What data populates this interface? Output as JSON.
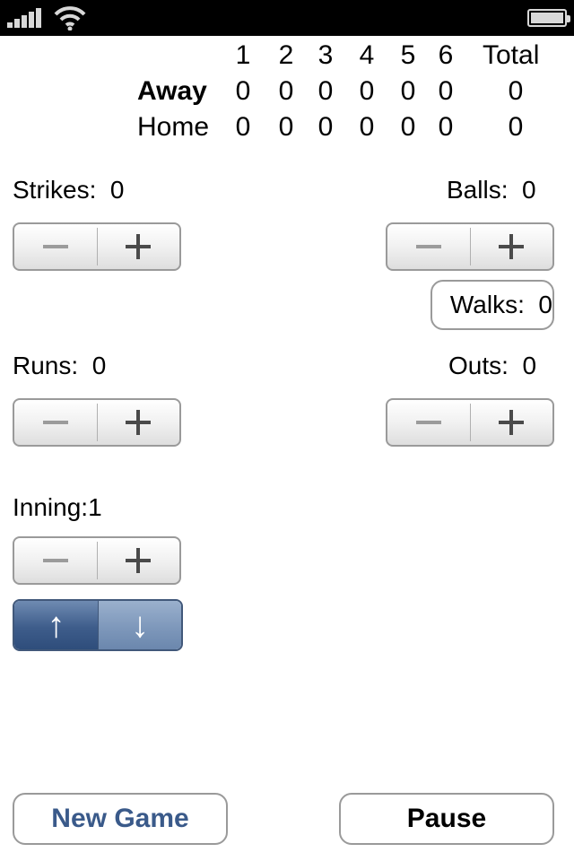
{
  "scoreboard": {
    "headers": [
      "1",
      "2",
      "3",
      "4",
      "5",
      "6",
      "Total"
    ],
    "away": {
      "label": "Away",
      "scores": [
        "0",
        "0",
        "0",
        "0",
        "0",
        "0"
      ],
      "total": "0"
    },
    "home": {
      "label": "Home",
      "scores": [
        "0",
        "0",
        "0",
        "0",
        "0",
        "0"
      ],
      "total": "0"
    }
  },
  "counters": {
    "strikes": {
      "label": "Strikes:",
      "value": "0"
    },
    "balls": {
      "label": "Balls:",
      "value": "0"
    },
    "walks": {
      "label": "Walks:",
      "value": "0"
    },
    "runs": {
      "label": "Runs:",
      "value": "0"
    },
    "outs": {
      "label": "Outs:",
      "value": "0"
    },
    "inning": {
      "label": "Inning:",
      "value": "1"
    }
  },
  "half_toggle": {
    "up": "↑",
    "down": "↓",
    "selected": "up"
  },
  "buttons": {
    "new_game": "New Game",
    "pause": "Pause"
  },
  "colors": {
    "accent": "#3a5a8a",
    "toggle_selected": "#3e5d8b",
    "toggle_unselected": "#7e98bb"
  }
}
